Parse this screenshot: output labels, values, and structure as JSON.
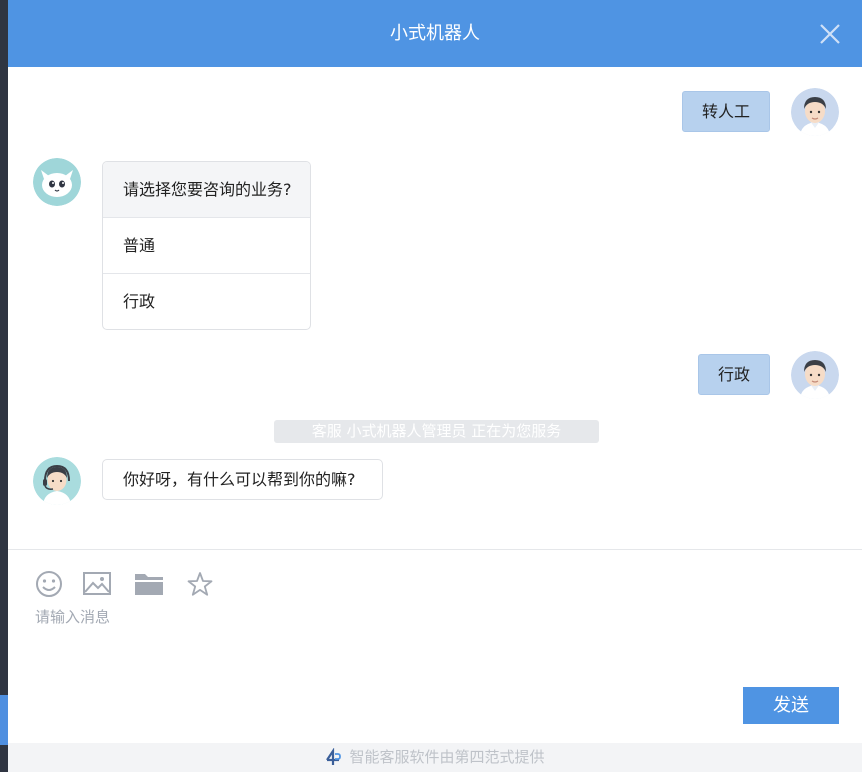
{
  "window": {
    "title": "小式机器人"
  },
  "messages": {
    "user_1": "转人工",
    "bot_prompt": "请选择您要咨询的业务?",
    "option_1": "普通",
    "option_2": "行政",
    "user_2": "行政",
    "service_notice": "客服 小式机器人管理员 正在为您服务",
    "bot_greeting": "你好呀，有什么可以帮到你的嘛?"
  },
  "input": {
    "placeholder": "请输入消息"
  },
  "toolbar": {
    "icons": [
      "emoji-icon",
      "image-icon",
      "folder-icon",
      "star-icon"
    ]
  },
  "send_label": "发送",
  "footer": {
    "text": "智能客服软件由第四范式提供"
  },
  "colors": {
    "accent": "#4f94e3",
    "user_bubble": "#b7d1ee"
  }
}
